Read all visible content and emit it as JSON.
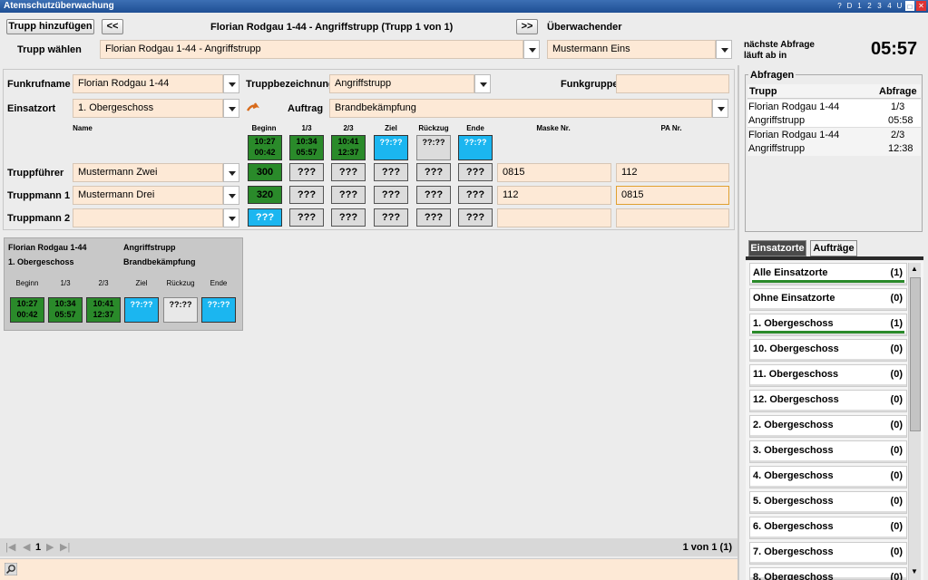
{
  "window": {
    "title": "Atemschutzüberwachung",
    "buttons": [
      "?",
      "D",
      "1",
      "2",
      "3",
      "4",
      "U"
    ]
  },
  "top": {
    "add_button": "Trupp hinzufügen",
    "prev_button": "<<",
    "next_button": ">>",
    "trupp_title": "Florian Rodgau 1-44 - Angriffstrupp (Trupp 1 von 1)",
    "ueberwachender_label": "Überwachender",
    "trupp_waehlen_label": "Trupp wählen",
    "trupp_waehlen_value": "Florian Rodgau 1-44 - Angriffstrupp",
    "ueberwachender_value": "Mustermann Eins",
    "naechste_abfrage_line1": "nächste Abfrage",
    "naechste_abfrage_line2": "läuft ab in",
    "countdown": "05:57"
  },
  "form": {
    "funkrufname_label": "Funkrufname",
    "funkrufname_value": "Florian Rodgau 1-44",
    "truppbezeichnung_label": "Truppbezeichnung",
    "truppbezeichnung_value": "Angriffstrupp",
    "funkgruppe_label": "Funkgruppe",
    "funkgruppe_value": "",
    "einsatzort_label": "Einsatzort",
    "einsatzort_value": "1. Obergeschoss",
    "auftrag_label": "Auftrag",
    "auftrag_value": "Brandbekämpfung",
    "col_name": "Name",
    "col_beginn": "Beginn",
    "col_13": "1/3",
    "col_23": "2/3",
    "col_ziel": "Ziel",
    "col_rueckzug": "Rückzug",
    "col_ende": "Ende",
    "col_maske": "Maske Nr.",
    "col_pa": "PA Nr.",
    "times": {
      "beginn": [
        "10:27",
        "00:42"
      ],
      "t13": [
        "10:34",
        "05:57"
      ],
      "t23": [
        "10:41",
        "12:37"
      ],
      "ziel": "??:??",
      "rueckzug": "??:??",
      "ende": "??:??"
    },
    "rows": [
      {
        "role": "Truppführer",
        "name": "Mustermann Zwei",
        "beginn": "300",
        "t13": "???",
        "t23": "???",
        "ziel": "???",
        "rueckzug": "???",
        "ende": "???",
        "maske": "0815",
        "pa": "112"
      },
      {
        "role": "Truppmann 1",
        "name": "Mustermann Drei",
        "beginn": "320",
        "t13": "???",
        "t23": "???",
        "ziel": "???",
        "rueckzug": "???",
        "ende": "???",
        "maske": "112",
        "pa": "0815"
      },
      {
        "role": "Truppmann 2",
        "name": "",
        "beginn": "???",
        "t13": "???",
        "t23": "???",
        "ziel": "???",
        "rueckzug": "???",
        "ende": "???",
        "maske": "",
        "pa": ""
      }
    ]
  },
  "card": {
    "funkruf": "Florian Rodgau 1-44",
    "trupp": "Angriffstrupp",
    "ort": "1. Obergeschoss",
    "auftrag": "Brandbekämpfung",
    "headers": [
      "Beginn",
      "1/3",
      "2/3",
      "Ziel",
      "Rückzug",
      "Ende"
    ],
    "beginn": [
      "10:27",
      "00:42"
    ],
    "t13": [
      "10:34",
      "05:57"
    ],
    "t23": [
      "10:41",
      "12:37"
    ],
    "ziel": "??:??",
    "rueckzug": "??:??",
    "ende": "??:??"
  },
  "abfragen": {
    "title": "Abfragen",
    "col_trupp": "Trupp",
    "col_abfrage": "Abfrage",
    "rows": [
      {
        "trupp1": "Florian Rodgau 1-44",
        "trupp2": "Angriffstrupp",
        "a1": "1/3",
        "a2": "05:58"
      },
      {
        "trupp1": "Florian Rodgau 1-44",
        "trupp2": "Angriffstrupp",
        "a1": "2/3",
        "a2": "12:38"
      }
    ]
  },
  "tabs": {
    "einsatzorte": "Einsatzorte",
    "auftraege": "Aufträge"
  },
  "locations": [
    {
      "name": "Alle Einsatzorte",
      "count": "(1)"
    },
    {
      "name": "Ohne Einsatzorte",
      "count": "(0)"
    },
    {
      "name": "1. Obergeschoss",
      "count": "(1)"
    },
    {
      "name": "10. Obergeschoss",
      "count": "(0)"
    },
    {
      "name": "11. Obergeschoss",
      "count": "(0)"
    },
    {
      "name": "12. Obergeschoss",
      "count": "(0)"
    },
    {
      "name": "2. Obergeschoss",
      "count": "(0)"
    },
    {
      "name": "3. Obergeschoss",
      "count": "(0)"
    },
    {
      "name": "4. Obergeschoss",
      "count": "(0)"
    },
    {
      "name": "5. Obergeschoss",
      "count": "(0)"
    },
    {
      "name": "6. Obergeschoss",
      "count": "(0)"
    },
    {
      "name": "7. Obergeschoss",
      "count": "(0)"
    },
    {
      "name": "8. Obergeschoss",
      "count": "(0)"
    }
  ],
  "pager": {
    "page": "1",
    "info": "1 von 1 (1)"
  },
  "colors": {
    "green": "#2a8a2a",
    "blue": "#1bb6f0",
    "field": "#fde9d6"
  }
}
